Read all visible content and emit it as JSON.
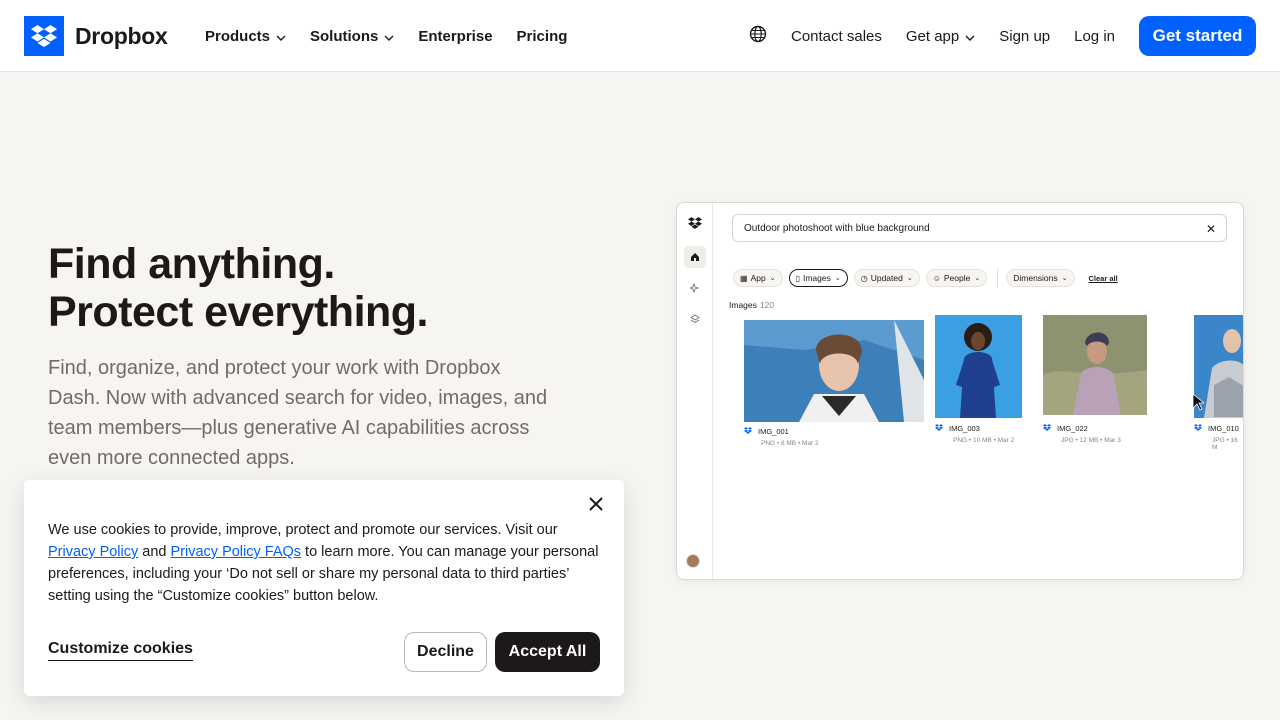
{
  "nav": {
    "brand": "Dropbox",
    "left_items": [
      {
        "label": "Products"
      },
      {
        "label": "Solutions"
      },
      {
        "label": "Enterprise"
      },
      {
        "label": "Pricing"
      }
    ],
    "right_items": [
      {
        "label": "Contact sales"
      },
      {
        "label": "Get app"
      },
      {
        "label": "Sign up"
      },
      {
        "label": "Log in"
      }
    ],
    "cta": "Get started"
  },
  "hero": {
    "title_line1": "Find anything.",
    "title_line2": "Protect everything.",
    "subtitle": "Find, organize, and protect your work with Dropbox Dash. Now with advanced search for video, images, and team members—plus generative AI capabilities across even more connected apps."
  },
  "mockup": {
    "search_query": "Outdoor photoshoot with blue background",
    "filters": [
      {
        "label": "App"
      },
      {
        "label": "Images"
      },
      {
        "label": "Updated"
      },
      {
        "label": "People"
      },
      {
        "label": "Dimensions"
      }
    ],
    "clear_label": "Clear all",
    "images_label": "Images",
    "images_count": "120",
    "images": [
      {
        "name": "IMG_001",
        "meta": "PNG • 8 MB • Mar 2"
      },
      {
        "name": "IMG_003",
        "meta": "PNG • 10 MB • Mar 2"
      },
      {
        "name": "IMG_022",
        "meta": "JPG • 12 MB • Mar 3"
      },
      {
        "name": "IMG_010",
        "meta": "JPG • 16 M"
      }
    ]
  },
  "cookie": {
    "text_before": "We use cookies to provide, improve, protect and promote our services. Visit our ",
    "link1": "Privacy Policy",
    "and": " and ",
    "link2": "Privacy Policy FAQs",
    "text_after": " to learn more. You can manage your personal preferences, including your ‘Do not sell or share my personal data to third parties’ setting using the “Customize cookies” button below.",
    "customize": "Customize cookies",
    "decline": "Decline",
    "accept": "Accept All"
  },
  "colors": {
    "brand_blue": "#0061fe",
    "page_bg": "#f7f5f2",
    "text_dark": "#1e1919",
    "text_muted": "#736c64"
  }
}
